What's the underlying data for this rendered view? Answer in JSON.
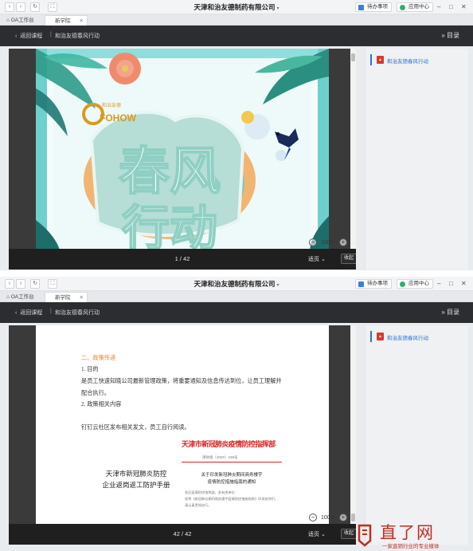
{
  "window": {
    "title": "天津和治友德制药有限公司",
    "todo_label": "待办事项",
    "app_center_label": "应用中心"
  },
  "tabs": [
    {
      "label": "OA工作台"
    },
    {
      "label": "新学院"
    }
  ],
  "header": {
    "back_label": "返回课程",
    "separator": "|",
    "doc_title": "和治友德春风行动",
    "toc_label": "目录"
  },
  "toc": {
    "items": [
      {
        "label": "和治友德春风行动"
      }
    ]
  },
  "screen1": {
    "brand_sub": "和治友德",
    "brand_logo": "FOHOW",
    "cover_line1": "春风",
    "cover_line2": "行动",
    "zoom": "100%",
    "page_indicator": "1 / 42",
    "fit_label": "适页",
    "close_label": "收起"
  },
  "screen2": {
    "section_heading": "二、政策传递",
    "line1": "1. 目的",
    "line2": "是员工快速知晓公司最新管理政策，将重要通知及信息传达到位，让员工理解并",
    "line3": "配合执行。",
    "line4": "2. 政策相关内容",
    "line5": "钉钉云社区发布相关发文，员工自行阅读。",
    "manual_line1": "天津市新冠肺炎防控",
    "manual_line2": "企业返岗返工防护手册",
    "notice_red_title": "天津市新冠肺炎疫情防控指挥部",
    "notice_doc_no": "津防指〔2020〕199号",
    "notice_title_line1": "关于印发新冠肺炎期间商务楼宇",
    "notice_title_line2": "疫情防控措施指南的通知",
    "notice_small1": "各区疫情防控指挥部，各有关单位：",
    "notice_small2": "现将《新冠肺炎期间商务楼宇疫情防控措施指南》印发给你们，",
    "notice_small3": "请认真贯彻执行。",
    "zoom": "100%",
    "page_indicator": "42 / 42",
    "fit_label": "适页",
    "close_label": "收起"
  },
  "watermark": {
    "name": "直了网",
    "slogan": "一家直销行业的专业媒体"
  },
  "colors": {
    "header_bg": "#2b2d30",
    "accent_blue": "#2b71d9",
    "pdf_red": "#d93a2e",
    "heading_orange": "#e7833a",
    "watermark_red": "#c22c22"
  }
}
